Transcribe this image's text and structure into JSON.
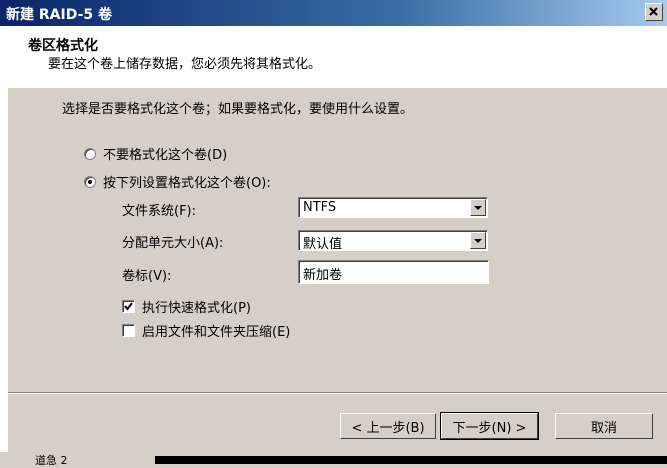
{
  "window": {
    "title": "新建 RAID-5 卷"
  },
  "header": {
    "title": "卷区格式化",
    "subtitle": "要在这个卷上储存数据，您必须先将其格式化。"
  },
  "intro": "选择是否要格式化这个卷；如果要格式化，要使用什么设置。",
  "options": {
    "no_format": {
      "label": "不要格式化这个卷(D)",
      "selected": false
    },
    "format": {
      "label": "按下列设置格式化这个卷(O):",
      "selected": true
    }
  },
  "fields": {
    "filesystem": {
      "label": "文件系统(F):",
      "value": "NTFS"
    },
    "alloc_size": {
      "label": "分配单元大小(A):",
      "value": "默认值"
    },
    "volume_label": {
      "label": "卷标(V):",
      "value": "新加卷"
    }
  },
  "checkboxes": {
    "quick_format": {
      "label": "执行快速格式化(P)",
      "checked": true
    },
    "compression": {
      "label": "启用文件和文件夹压缩(E)",
      "checked": false
    }
  },
  "buttons": {
    "back": "< 上一步(B)",
    "next": "下一步(N) >",
    "cancel": "取消"
  },
  "background_text": "道急 2"
}
